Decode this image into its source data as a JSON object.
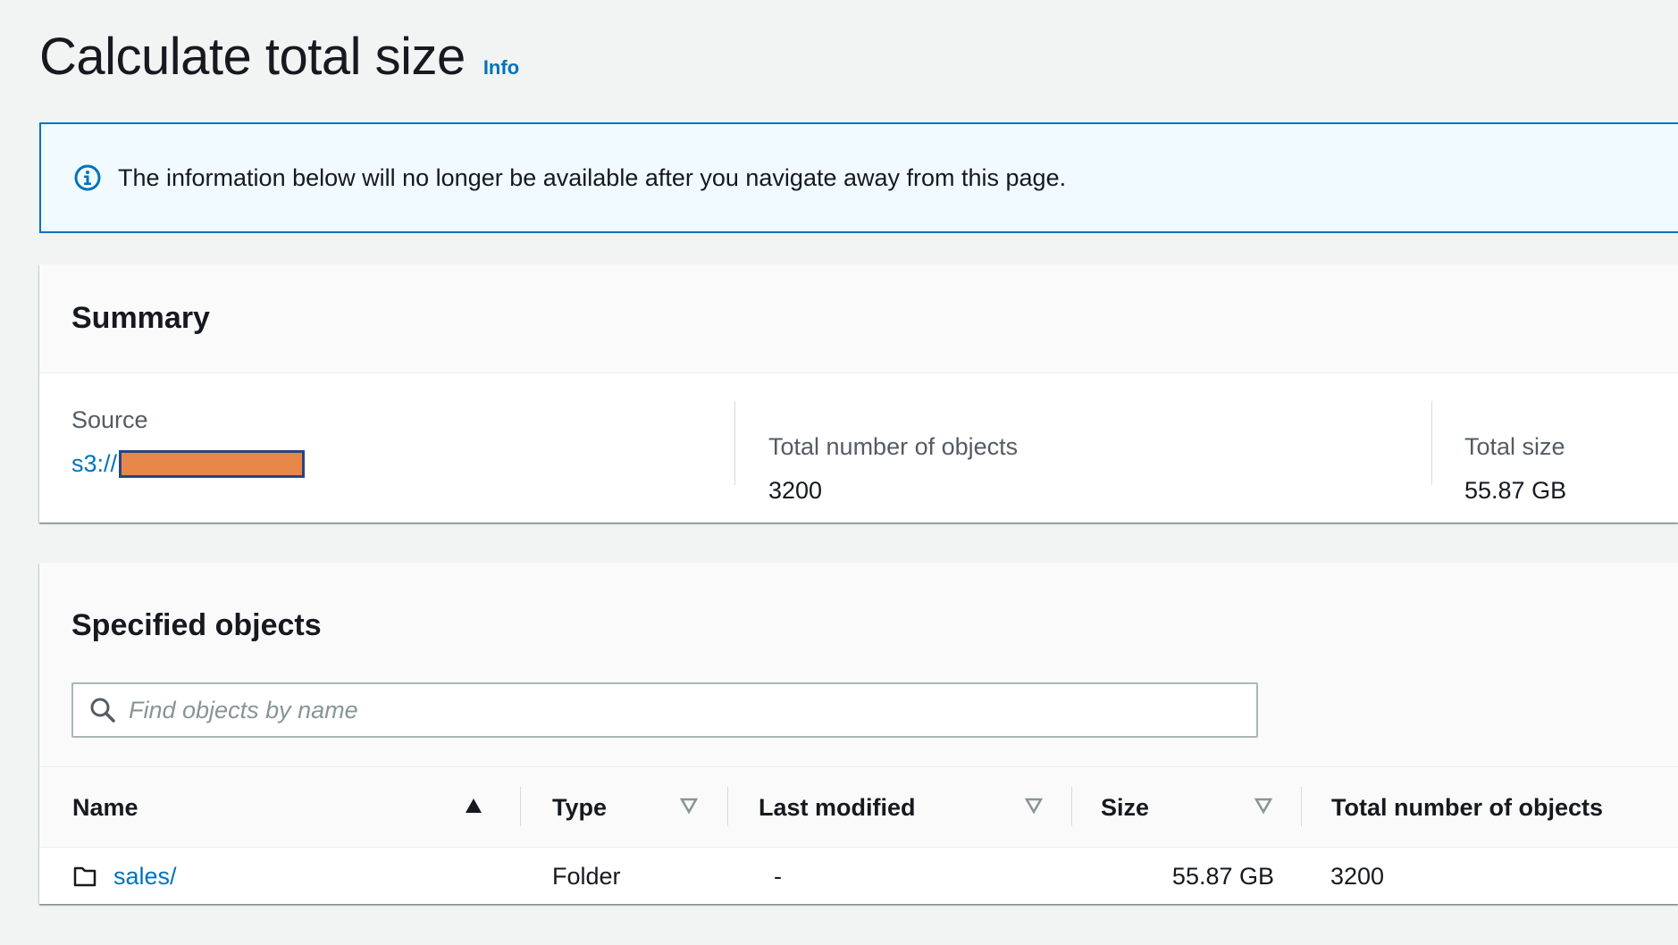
{
  "header": {
    "title": "Calculate total size",
    "info_label": "Info"
  },
  "alert": {
    "icon": "info-circle-icon",
    "message": "The information below will no longer be available after you navigate away from this page."
  },
  "summary": {
    "title": "Summary",
    "source_label": "Source",
    "source_prefix": "s3://",
    "objects_label": "Total number of objects",
    "objects_value": "3200",
    "size_label": "Total size",
    "size_value": "55.87 GB"
  },
  "specified_objects": {
    "title": "Specified objects",
    "search_placeholder": "Find objects by name",
    "columns": [
      "Name",
      "Type",
      "Last modified",
      "Size",
      "Total number of objects"
    ],
    "rows": [
      {
        "icon": "folder-icon",
        "name": "sales/",
        "type": "Folder",
        "last_modified": "-",
        "size": "55.87 GB",
        "total_objects": "3200"
      }
    ]
  },
  "colors": {
    "link": "#0073bb",
    "alert_bg": "#f1faff",
    "redaction": "#e8874a"
  }
}
